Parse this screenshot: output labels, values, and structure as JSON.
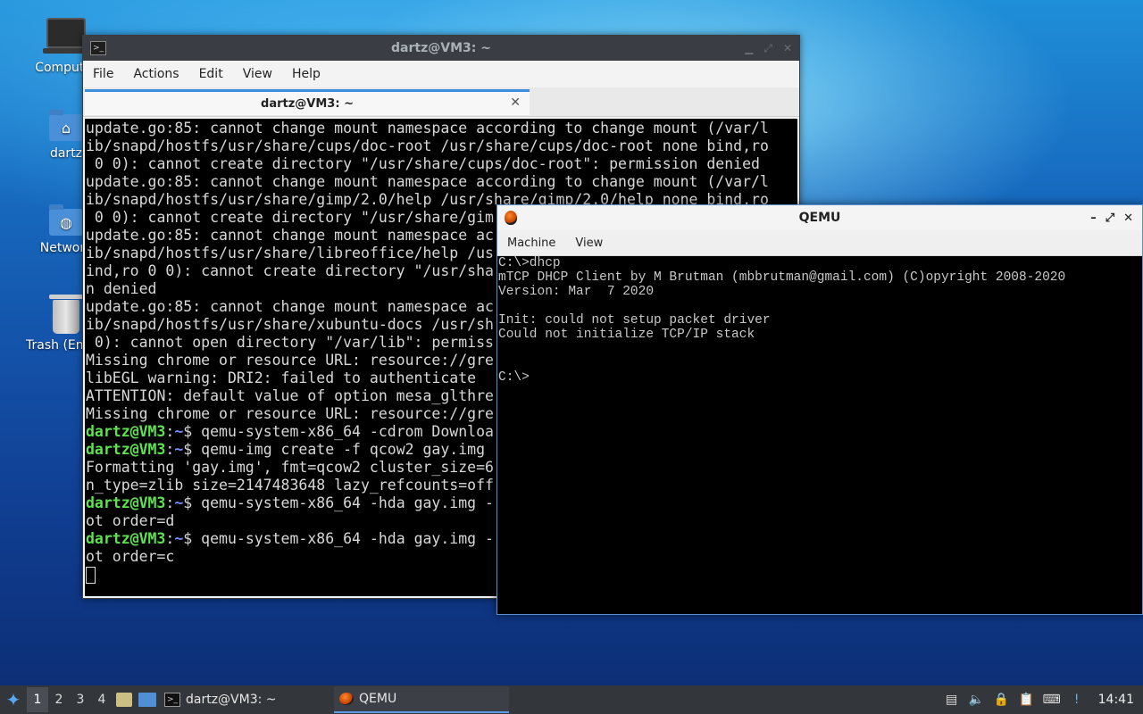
{
  "desktop": {
    "icons": [
      {
        "label": "Computer"
      },
      {
        "label": "dartz"
      },
      {
        "label": "Network"
      },
      {
        "label": "Trash (Empty)"
      }
    ]
  },
  "terminal": {
    "title": "dartz@VM3: ~",
    "menu": [
      "File",
      "Actions",
      "Edit",
      "View",
      "Help"
    ],
    "tab_label": "dartz@VM3: ~",
    "prompt_user": "dartz@VM3",
    "prompt_sep": ":",
    "prompt_path": "~",
    "prompt_sym": "$ ",
    "lines": [
      {
        "t": "text",
        "v": "update.go:85: cannot change mount namespace according to change mount (/var/l"
      },
      {
        "t": "text",
        "v": "ib/snapd/hostfs/usr/share/cups/doc-root /usr/share/cups/doc-root none bind,ro"
      },
      {
        "t": "text",
        "v": " 0 0): cannot create directory \"/usr/share/cups/doc-root\": permission denied"
      },
      {
        "t": "text",
        "v": "update.go:85: cannot change mount namespace according to change mount (/var/l"
      },
      {
        "t": "text",
        "v": "ib/snapd/hostfs/usr/share/gimp/2.0/help /usr/share/gimp/2.0/help none bind,ro"
      },
      {
        "t": "text",
        "v": " 0 0): cannot create directory \"/usr/share/gim"
      },
      {
        "t": "text",
        "v": "update.go:85: cannot change mount namespace ac"
      },
      {
        "t": "text",
        "v": "ib/snapd/hostfs/usr/share/libreoffice/help /us"
      },
      {
        "t": "text",
        "v": "ind,ro 0 0): cannot create directory \"/usr/sha"
      },
      {
        "t": "text",
        "v": "n denied"
      },
      {
        "t": "text",
        "v": "update.go:85: cannot change mount namespace ac"
      },
      {
        "t": "text",
        "v": "ib/snapd/hostfs/usr/share/xubuntu-docs /usr/sh"
      },
      {
        "t": "text",
        "v": " 0): cannot open directory \"/var/lib\": permiss"
      },
      {
        "t": "text",
        "v": "Missing chrome or resource URL: resource://gre"
      },
      {
        "t": "text",
        "v": "libEGL warning: DRI2: failed to authenticate"
      },
      {
        "t": "text",
        "v": "ATTENTION: default value of option mesa_glthre"
      },
      {
        "t": "text",
        "v": "Missing chrome or resource URL: resource://gre"
      },
      {
        "t": "prompt",
        "v": "qemu-system-x86_64 -cdrom Downloa"
      },
      {
        "t": "prompt",
        "v": "qemu-img create -f qcow2 gay.img"
      },
      {
        "t": "text",
        "v": "Formatting 'gay.img', fmt=qcow2 cluster_size=6"
      },
      {
        "t": "text",
        "v": "n_type=zlib size=2147483648 lazy_refcounts=off"
      },
      {
        "t": "prompt",
        "v": "qemu-system-x86_64 -hda gay.img -"
      },
      {
        "t": "text",
        "v": "ot order=d"
      },
      {
        "t": "prompt",
        "v": "qemu-system-x86_64 -hda gay.img -"
      },
      {
        "t": "text",
        "v": "ot order=c"
      },
      {
        "t": "cursor",
        "v": ""
      }
    ]
  },
  "qemu": {
    "title": "QEMU",
    "menu": [
      "Machine",
      "View"
    ],
    "screen_lines": [
      "C:\\>dhcp",
      "mTCP DHCP Client by M Brutman (mbbrutman@gmail.com) (C)opyright 2008-2020",
      "Version: Mar  7 2020",
      "",
      "Init: could not setup packet driver",
      "Could not initialize TCP/IP stack",
      "",
      "",
      "C:\\>"
    ]
  },
  "taskbar": {
    "workspaces": [
      "1",
      "2",
      "3",
      "4"
    ],
    "active_workspace": "1",
    "tasks": [
      {
        "label": "dartz@VM3: ~",
        "icon": "terminal-icon"
      },
      {
        "label": "QEMU",
        "icon": "qemu-icon"
      }
    ],
    "clock": "14:41"
  },
  "colors": {
    "accent": "#3d8ee0",
    "prompt_user": "#5fe24f",
    "prompt_path": "#7b8cff"
  }
}
